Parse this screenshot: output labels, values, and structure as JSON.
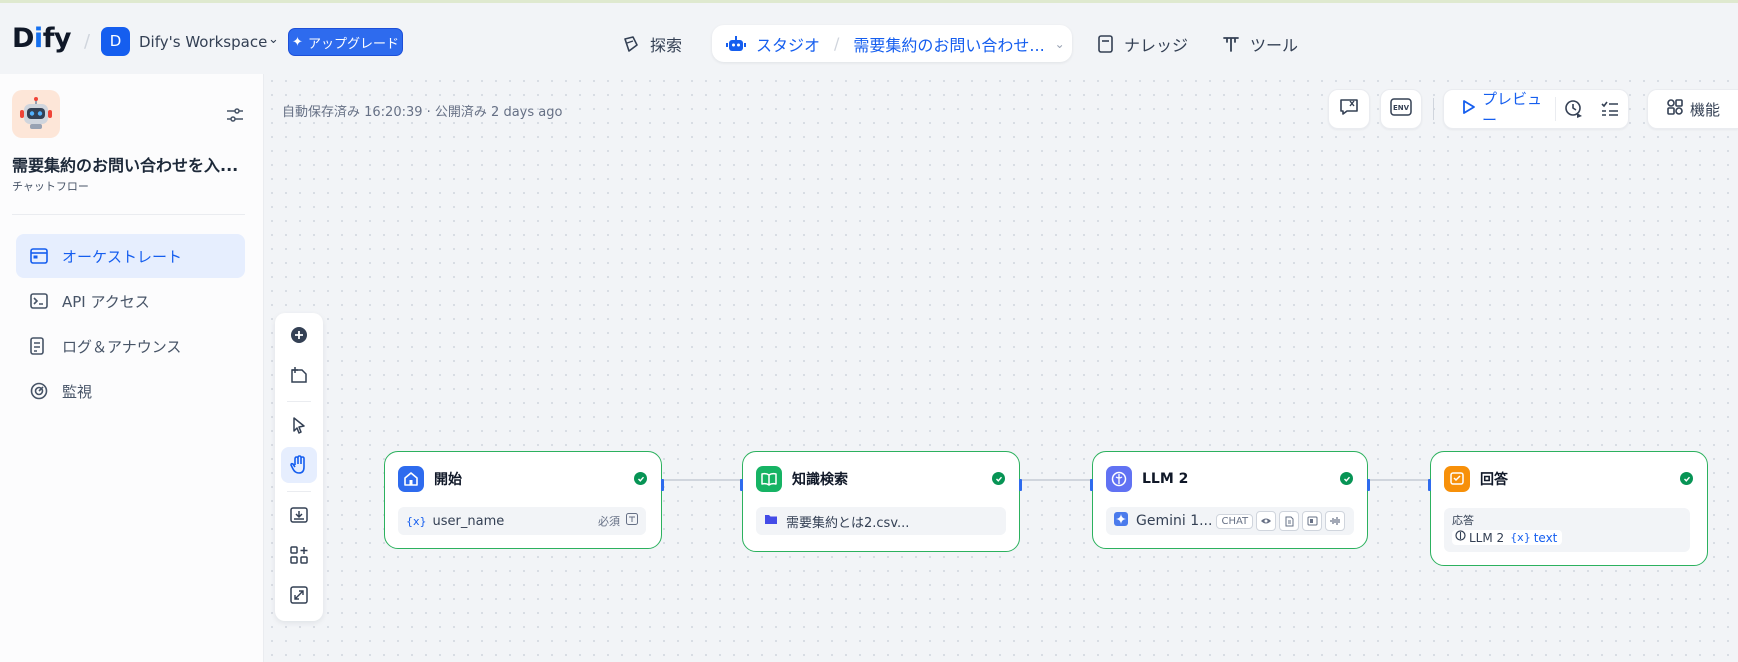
{
  "header": {
    "logo": "Dify",
    "workspace_initial": "D",
    "workspace_name": "Dify's Workspace",
    "upgrade_label": "アップグレード",
    "nav": {
      "explore": "探索",
      "studio": "スタジオ",
      "current_app": "需要集約のお問い合わせ...",
      "knowledge": "ナレッジ",
      "tools": "ツール"
    }
  },
  "sidebar": {
    "app_title": "需要集約のお問い合わせを入...",
    "app_type": "チャットフロー",
    "items": [
      {
        "label": "オーケストレート",
        "icon": "orchestrate-icon",
        "active": true
      },
      {
        "label": "API アクセス",
        "icon": "terminal-icon",
        "active": false
      },
      {
        "label": "ログ＆アナウンス",
        "icon": "log-icon",
        "active": false
      },
      {
        "label": "監視",
        "icon": "monitor-icon",
        "active": false
      }
    ]
  },
  "canvas": {
    "autosave": "自動保存済み 16:20:39 · 公開済み 2 days ago",
    "toolbar": {
      "env_label": "ENV",
      "preview_label": "プレビュー",
      "feature_label": "機能"
    },
    "nodes": {
      "start": {
        "title": "開始",
        "var_name": "user_name",
        "required": "必須"
      },
      "knowledge": {
        "title": "知識検索",
        "dataset": "需要集約とは2.csv..."
      },
      "llm": {
        "title": "LLM 2",
        "model": "Gemini 1...",
        "mode_chip": "CHAT"
      },
      "answer": {
        "title": "回答",
        "label": "応答",
        "source_node": "LLM 2",
        "source_var": "text"
      }
    }
  },
  "colors": {
    "accent": "#155eef",
    "success": "#079455",
    "start_icon": "#2e6bee",
    "knowledge_icon": "#16b364",
    "llm_icon": "#6172f3",
    "answer_icon": "#f79009"
  }
}
